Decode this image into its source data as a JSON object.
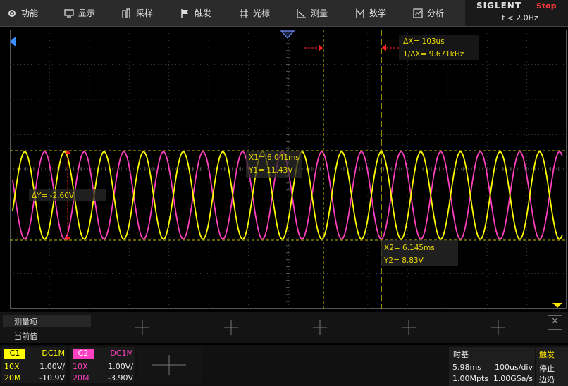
{
  "menu": {
    "items": [
      {
        "label": "功能",
        "icon": "gear-icon"
      },
      {
        "label": "显示",
        "icon": "monitor-icon"
      },
      {
        "label": "采样",
        "icon": "acquire-icon"
      },
      {
        "label": "触发",
        "icon": "flag-icon"
      },
      {
        "label": "光标",
        "icon": "cursor-icon"
      },
      {
        "label": "测量",
        "icon": "measure-icon"
      },
      {
        "label": "数学",
        "icon": "math-icon"
      },
      {
        "label": "分析",
        "icon": "analysis-icon"
      }
    ]
  },
  "brand": {
    "name": "SIGLENT",
    "status": "Stop",
    "frequency": "f < 2.0Hz"
  },
  "cursors": {
    "dx": "ΔX= 103us",
    "inv_dx": "1/ΔX= 9.671kHz",
    "x1": "X1= 6.041ms",
    "y1": "Y1= 11.43V",
    "dy": "ΔY= -2.60V",
    "x2": "X2= 6.145ms",
    "y2": "Y2= 8.83V"
  },
  "measure": {
    "title": "测量项",
    "current": "当前值",
    "close": "✕"
  },
  "channels": [
    {
      "name": "C1",
      "coupling": "DC1M",
      "probe": "10X",
      "scale": "1.00V/",
      "bw": "20M",
      "offset": "-10.9V",
      "color": "#ffff00"
    },
    {
      "name": "C2",
      "coupling": "DC1M",
      "probe": "10X",
      "scale": "1.00V/",
      "bw": "20M",
      "offset": "-3.90V",
      "color": "#ff40c0"
    }
  ],
  "timebase": {
    "title": "时基",
    "delay": "5.98ms",
    "scale": "100us/div",
    "depth": "1.00Mpts",
    "rate": "1.00GSa/s"
  },
  "trigger": {
    "title": "触发",
    "state": "停止",
    "edge": "边沿"
  },
  "colors": {
    "ch1": "#ffff00",
    "ch2": "#ff40c0",
    "cursor": "#e8d800",
    "marker": "#ff2020",
    "status": "#ff3b3b"
  }
}
